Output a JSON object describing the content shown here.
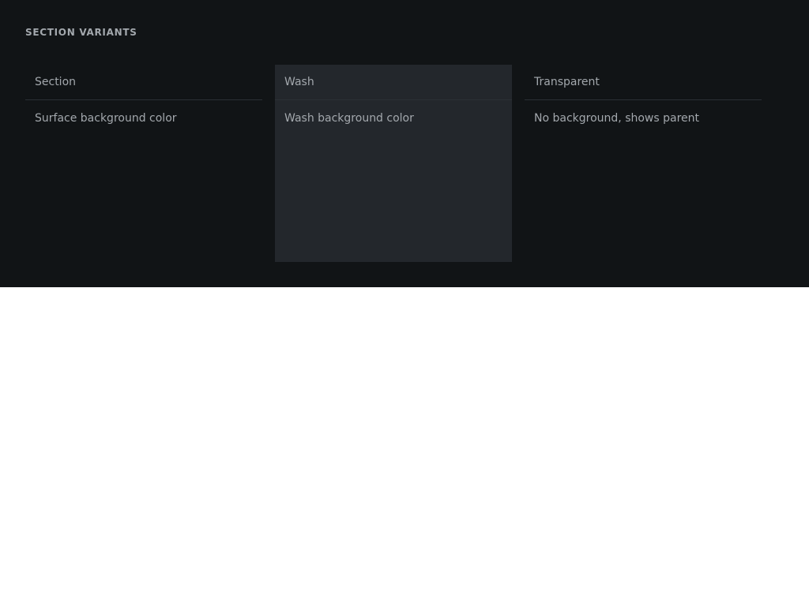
{
  "panel": {
    "title": "SECTION VARIANTS",
    "background": "#111416"
  },
  "variants": [
    {
      "label": "Section",
      "description": "Surface background color",
      "background": "#111416"
    },
    {
      "label": "Wash",
      "description": "Wash background color",
      "background": "#23272c"
    },
    {
      "label": "Transparent",
      "description": "No background, shows parent",
      "background": "transparent"
    }
  ],
  "colors": {
    "text": "#a3a8ad",
    "divider": "#2b3035",
    "page": "#ffffff"
  }
}
